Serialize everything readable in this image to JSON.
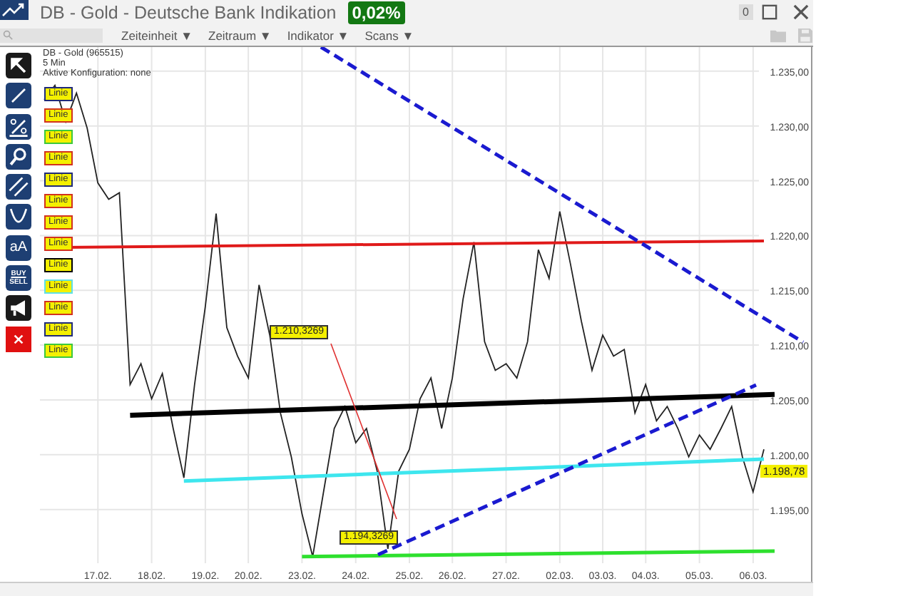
{
  "window": {
    "title": "DB - Gold - Deutsche Bank Indikation",
    "change_badge": "0,02%",
    "counter": "0"
  },
  "toolbar": {
    "menus": [
      "Zeiteinheit ▼",
      "Zeitraum ▼",
      "Indikator ▼",
      "Scans ▼"
    ]
  },
  "tools": [
    {
      "kind": "pointer"
    },
    {
      "kind": "line"
    },
    {
      "kind": "percent"
    },
    {
      "kind": "zoom"
    },
    {
      "kind": "parallel"
    },
    {
      "kind": "curve"
    },
    {
      "kind": "text",
      "label": "aA"
    },
    {
      "kind": "trade",
      "label": "BUY",
      "label_2": "SELL"
    },
    {
      "kind": "megaphone"
    },
    {
      "kind": "delete"
    }
  ],
  "chart": {
    "info": [
      "DB - Gold (965515)",
      "5 Min",
      "Aktive Konfiguration: none"
    ],
    "drawings": [
      {
        "label": "Linie",
        "color": "#1f2a7a"
      },
      {
        "label": "Linie",
        "color": "#d2321e"
      },
      {
        "label": "Linie",
        "color": "#3cc83c"
      },
      {
        "label": "Linie",
        "color": "#d2321e"
      },
      {
        "label": "Linie",
        "color": "#1f2a7a"
      },
      {
        "label": "Linie",
        "color": "#d2321e"
      },
      {
        "label": "Linie",
        "color": "#d2321e"
      },
      {
        "label": "Linie",
        "color": "#d2321e"
      },
      {
        "label": "Linie",
        "color": "#000000"
      },
      {
        "label": "Linie",
        "color": "#5ee0e6"
      },
      {
        "label": "Linie",
        "color": "#d2321e"
      },
      {
        "label": "Linie",
        "color": "#1f2a7a"
      },
      {
        "label": "Linie",
        "color": "#3cc83c"
      }
    ],
    "chart_data": {
      "type": "line",
      "grid": true,
      "ylim": [
        1190.1,
        1237.2
      ],
      "categories": [
        null,
        null,
        null,
        null,
        null,
        "17.02.",
        null,
        null,
        null,
        null,
        "18.02.",
        null,
        null,
        null,
        null,
        "19.02.",
        null,
        null,
        null,
        "20.02.",
        null,
        null,
        null,
        null,
        "23.02.",
        null,
        null,
        null,
        null,
        "24.02.",
        null,
        null,
        null,
        null,
        "25.02.",
        null,
        null,
        null,
        "26.02.",
        null,
        null,
        null,
        null,
        "27.02.",
        null,
        null,
        null,
        null,
        "02.03.",
        null,
        null,
        null,
        "03.03.",
        null,
        null,
        null,
        "04.03.",
        null,
        null,
        null,
        null,
        "05.03.",
        null,
        null,
        null,
        null,
        "06.03.",
        null,
        null
      ],
      "yticks": [
        {
          "value": 1235,
          "label": "1.235,00"
        },
        {
          "value": 1230,
          "label": "1.230,00"
        },
        {
          "value": 1225,
          "label": "1.225,00"
        },
        {
          "value": 1220,
          "label": "1.220,00"
        },
        {
          "value": 1215,
          "label": "1.215,00"
        },
        {
          "value": 1210,
          "label": "1.210,00"
        },
        {
          "value": 1205,
          "label": "1.205,00"
        },
        {
          "value": 1200,
          "label": "1.200,00"
        },
        {
          "value": 1195,
          "label": "1.195,00"
        }
      ],
      "series": [
        {
          "color": "#222222",
          "values": [
            1232.4,
            1233.7,
            1230.4,
            1233.0,
            1229.8,
            1224.8,
            1223.3,
            1223.9,
            1206.4,
            1208.3,
            1205.1,
            1207.4,
            1202.4,
            1197.9,
            1206.4,
            1213.5,
            1222.0,
            1211.6,
            1209.0,
            1207.0,
            1215.5,
            1210.9,
            1203.8,
            1199.8,
            1194.6,
            1190.7,
            1196.6,
            1202.4,
            1204.4,
            1201.1,
            1202.4,
            1198.5,
            1191.4,
            1198.5,
            1200.5,
            1205.1,
            1207.0,
            1202.4,
            1207.0,
            1214.2,
            1219.4,
            1210.3,
            1207.7,
            1208.3,
            1207.0,
            1210.3,
            1218.7,
            1216.1,
            1222.2,
            1217.4,
            1212.2,
            1207.7,
            1210.9,
            1209.0,
            1209.6,
            1203.8,
            1206.4,
            1203.1,
            1204.4,
            1202.4,
            1199.8,
            1201.8,
            1200.5,
            1202.4,
            1204.4,
            1199.8,
            1196.6,
            1200.5,
            null
          ]
        },
        {
          "color": "#e01a1a",
          "values": [
            1218.9,
            null,
            null,
            null,
            null,
            null,
            null,
            null,
            null,
            null,
            null,
            null,
            null,
            null,
            null,
            null,
            null,
            null,
            null,
            null,
            null,
            null,
            null,
            null,
            null,
            null,
            null,
            null,
            null,
            null,
            null,
            null,
            null,
            null,
            null,
            null,
            null,
            null,
            null,
            null,
            null,
            null,
            null,
            null,
            null,
            null,
            null,
            null,
            null,
            null,
            null,
            null,
            null,
            null,
            null,
            null,
            null,
            null,
            null,
            null,
            null,
            null,
            null,
            null,
            null,
            null,
            null,
            1219.5,
            null
          ]
        },
        {
          "color": "#000000",
          "values": [
            null,
            null,
            null,
            null,
            null,
            null,
            null,
            null,
            1203.6,
            null,
            null,
            null,
            null,
            null,
            null,
            null,
            null,
            null,
            null,
            null,
            null,
            null,
            null,
            null,
            null,
            null,
            null,
            null,
            null,
            null,
            null,
            null,
            null,
            null,
            null,
            null,
            null,
            null,
            null,
            null,
            null,
            null,
            null,
            null,
            null,
            null,
            null,
            null,
            null,
            null,
            null,
            null,
            null,
            null,
            null,
            null,
            null,
            null,
            null,
            null,
            null,
            null,
            null,
            null,
            null,
            null,
            null,
            null,
            1205.5
          ]
        },
        {
          "color": "#3ee6ee",
          "values": [
            null,
            null,
            null,
            null,
            null,
            null,
            null,
            null,
            null,
            null,
            null,
            null,
            null,
            1197.6,
            null,
            null,
            null,
            null,
            null,
            null,
            null,
            null,
            null,
            null,
            null,
            null,
            null,
            null,
            null,
            null,
            null,
            null,
            null,
            null,
            null,
            null,
            null,
            null,
            null,
            null,
            null,
            null,
            null,
            null,
            null,
            null,
            null,
            null,
            null,
            null,
            null,
            null,
            null,
            null,
            null,
            null,
            null,
            null,
            null,
            null,
            null,
            null,
            null,
            null,
            null,
            null,
            null,
            1199.6,
            null
          ]
        },
        {
          "color": "#2ee02e",
          "values": [
            null,
            null,
            null,
            null,
            null,
            null,
            null,
            null,
            null,
            null,
            null,
            null,
            null,
            null,
            null,
            null,
            null,
            null,
            null,
            null,
            null,
            null,
            null,
            null,
            1190.7,
            null,
            null,
            null,
            null,
            null,
            null,
            null,
            null,
            null,
            null,
            null,
            null,
            null,
            null,
            null,
            null,
            null,
            null,
            null,
            null,
            null,
            null,
            null,
            null,
            null,
            null,
            null,
            null,
            null,
            null,
            null,
            null,
            null,
            null,
            null,
            null,
            null,
            null,
            null,
            null,
            null,
            null,
            null,
            1191.2
          ]
        }
      ],
      "annotations": [
        "1.210,3269",
        "1.194,3269"
      ]
    },
    "last_price": "1.198,78"
  }
}
